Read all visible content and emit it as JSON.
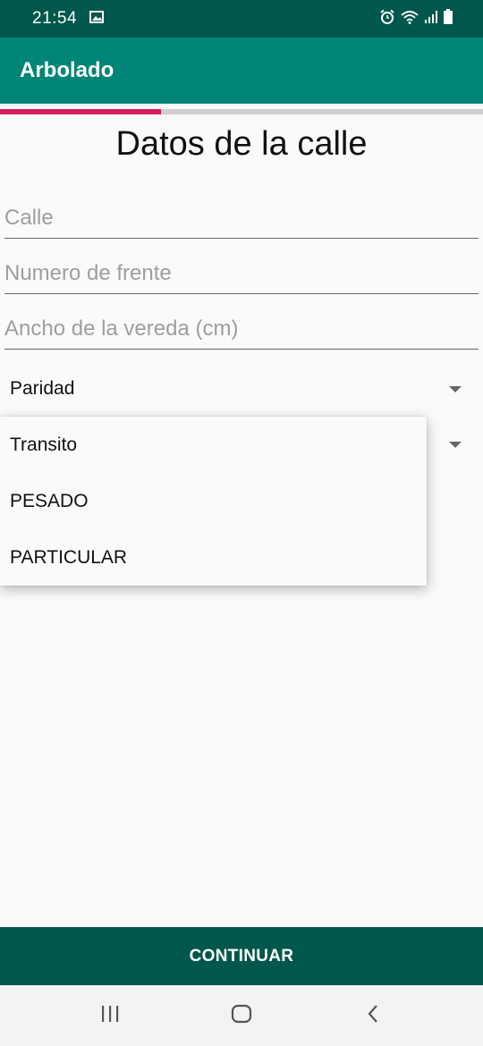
{
  "status_bar": {
    "time": "21:54",
    "icons": [
      "image-icon",
      "alarm-icon",
      "wifi-icon",
      "signal-icon",
      "battery-icon"
    ]
  },
  "app_bar": {
    "title": "Arbolado"
  },
  "progress": {
    "fraction": 0.333,
    "color": "#d81b60"
  },
  "form": {
    "title": "Datos de la calle",
    "calle_placeholder": "Calle",
    "numero_placeholder": "Numero de frente",
    "ancho_placeholder": "Ancho de la vereda (cm)",
    "paridad_value": "Paridad"
  },
  "dropdown": {
    "items": [
      "Transito",
      "PESADO",
      "PARTICULAR"
    ]
  },
  "actions": {
    "continue_label": "CONTINUAR"
  },
  "nav": {
    "icons": [
      "recent-apps-icon",
      "home-icon",
      "back-icon"
    ]
  },
  "colors": {
    "primary": "#008577",
    "primary_dark": "#00574b",
    "accent": "#d81b60"
  }
}
